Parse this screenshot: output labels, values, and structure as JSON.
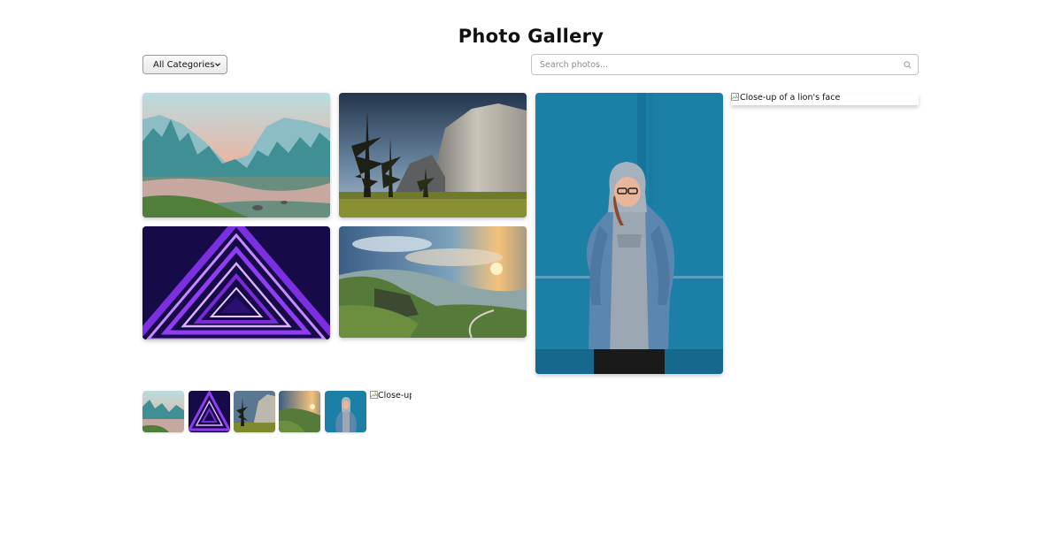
{
  "page": {
    "title": "Photo Gallery"
  },
  "filter": {
    "selected": "All Categories"
  },
  "search": {
    "placeholder": "Search photos..."
  },
  "gallery": {
    "broken_alt": "Close-up of a lion's face",
    "broken_thumb_alt": "Close-up of a lion's face"
  },
  "icons": {
    "search": "magnifier-icon",
    "select_arrow": "chevron-down-icon",
    "broken_image": "broken-image-icon"
  }
}
